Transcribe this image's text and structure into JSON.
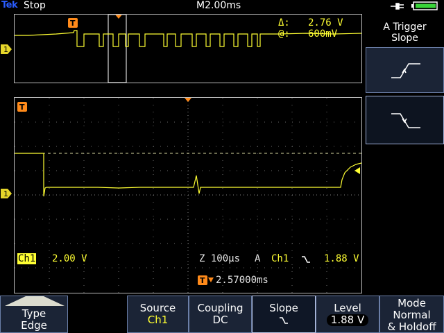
{
  "status": {
    "brand": "Tek",
    "run_state": "Stop",
    "timebase": "M2.00ms",
    "power_icon": "ac-power-icon",
    "battery_icon": "battery-icon"
  },
  "zoom": {
    "delta_label": "Δ:",
    "delta_value": "2.76 V",
    "at_label": "@:",
    "at_value": "600mV",
    "trigger_marker": "T"
  },
  "main": {
    "trigger_marker": "T",
    "ch1_marker": "1",
    "ch1_label": "Ch1",
    "ch1_scale": "2.00 V",
    "zoom_readout": "Z 100µs",
    "trigger_readout_a": "A",
    "trigger_readout_ch": "Ch1",
    "trigger_readout_slope": "\\",
    "trigger_readout_level": "1.88 V",
    "delay_readout": "2.57000ms"
  },
  "side_menu": {
    "title_line1": "A Trigger",
    "title_line2": "Slope",
    "rising_icon": "rising-edge-icon",
    "falling_icon": "falling-edge-icon"
  },
  "bottom_menu": {
    "type_label": "Type",
    "type_value": "Edge",
    "source_label": "Source",
    "source_value": "Ch1",
    "coupling_label": "Coupling",
    "coupling_value": "DC",
    "slope_label": "Slope",
    "slope_value": "\\",
    "level_label": "Level",
    "level_value": "1.88 V",
    "mode_line1": "Mode",
    "mode_line2": "Normal",
    "mode_line3": "& Holdoff"
  },
  "colors": {
    "trace": "#ffff33",
    "trigger": "#ff8a1a",
    "menu_bg": "#1b2436"
  }
}
